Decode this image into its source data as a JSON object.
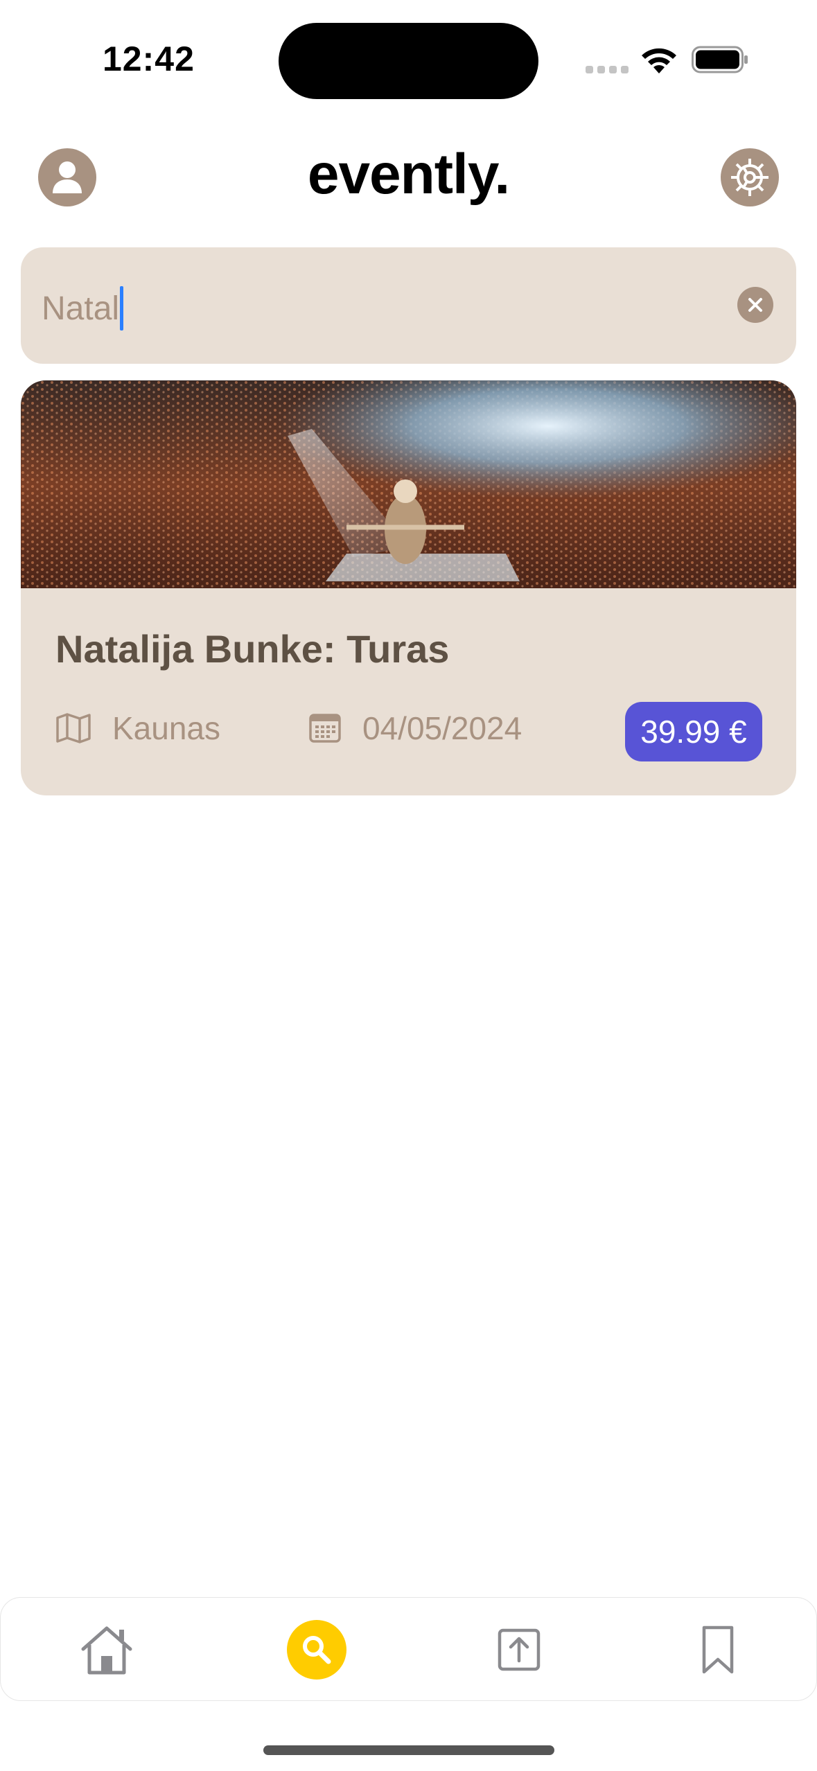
{
  "status_bar": {
    "time": "12:42",
    "icons": [
      "cellular-signal-icon",
      "wifi-icon",
      "battery-icon"
    ]
  },
  "header": {
    "brand": "evently.",
    "left_icon": "person-icon",
    "right_icon": "gear-icon"
  },
  "search": {
    "value": "Natal",
    "clear_icon": "clear-x-icon"
  },
  "results": [
    {
      "title": "Natalija Bunke: Turas",
      "location": "Kaunas",
      "date": "04/05/2024",
      "price": "39.99 €",
      "location_icon": "map-icon",
      "date_icon": "calendar-icon"
    }
  ],
  "tab_bar": {
    "tabs": [
      {
        "icon": "home-icon",
        "active": false
      },
      {
        "icon": "search-icon",
        "active": true
      },
      {
        "icon": "upload-icon",
        "active": false
      },
      {
        "icon": "bookmark-icon",
        "active": false
      }
    ]
  },
  "colors": {
    "accent_beige": "#e9dfd5",
    "muted_brown": "#a89281",
    "title_brown": "#5e5144",
    "price_purple": "#5854d6",
    "active_tab_yellow": "#ffcc00",
    "caret_blue": "#2a7fff"
  }
}
